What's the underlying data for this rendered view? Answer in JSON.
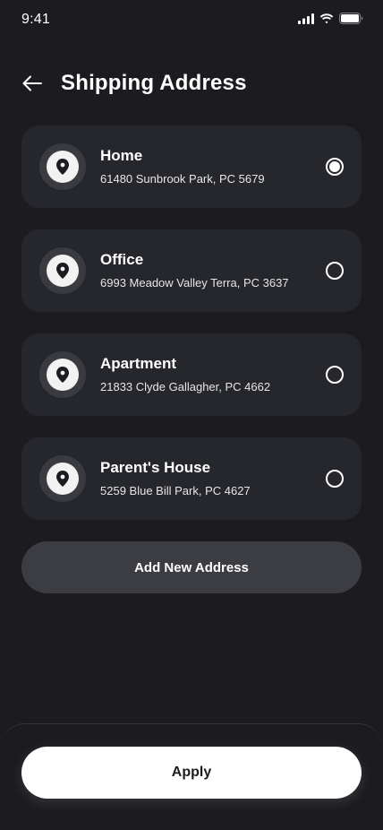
{
  "status_bar": {
    "time": "9:41",
    "icons": [
      "cellular-signal-icon",
      "wifi-icon",
      "battery-icon"
    ]
  },
  "header": {
    "back_icon": "arrow-left-icon",
    "title": "Shipping Address"
  },
  "addresses": [
    {
      "name": "Home",
      "address": "61480 Sunbrook Park, PC 5679",
      "selected": true
    },
    {
      "name": "Office",
      "address": "6993 Meadow Valley Terra, PC 3637",
      "selected": false
    },
    {
      "name": "Apartment",
      "address": "21833 Clyde Gallagher, PC 4662",
      "selected": false
    },
    {
      "name": "Parent's House",
      "address": "5259 Blue Bill Park, PC 4627",
      "selected": false
    }
  ],
  "add_button_label": "Add New Address",
  "apply_button_label": "Apply",
  "colors": {
    "background": "#1c1c20",
    "card": "#26272c",
    "add_button": "#3c3d43",
    "apply_button": "#ffffff"
  }
}
